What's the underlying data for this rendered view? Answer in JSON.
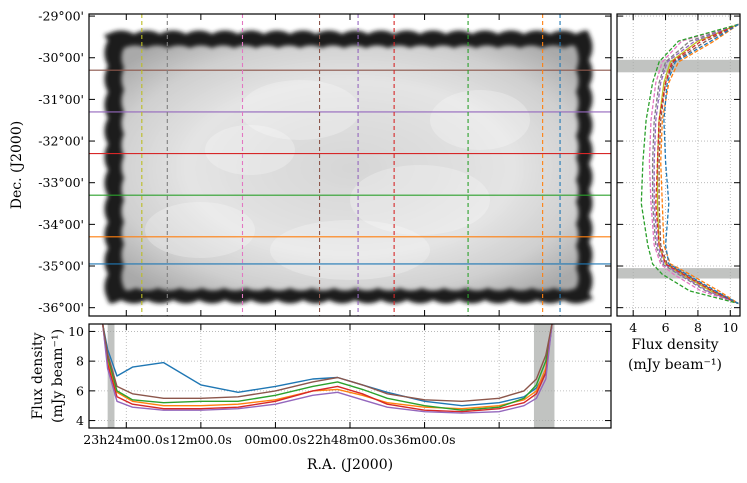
{
  "chart_data": [
    {
      "type": "heatmap",
      "xlabel": "",
      "ylabel": "Dec. (J2000)",
      "ytick_labels": [
        "-29°00'",
        "-30°00'",
        "-31°00'",
        "-32°00'",
        "-33°00'",
        "-34°00'",
        "-35°00'",
        "-36°00'"
      ],
      "ylim": [
        -36.2,
        -28.95
      ],
      "colormap": "grayscale",
      "horizontal_cuts": [
        {
          "dec": -30.3,
          "color": "#8c564b"
        },
        {
          "dec": -31.3,
          "color": "#9467bd"
        },
        {
          "dec": -32.3,
          "color": "#d62728"
        },
        {
          "dec": -33.3,
          "color": "#2ca02c"
        },
        {
          "dec": -34.3,
          "color": "#ff7f0e"
        },
        {
          "dec": -34.95,
          "color": "#1f77b4"
        }
      ],
      "vertical_cuts": [
        {
          "ra_min": -33.5,
          "color": "#bcbd22"
        },
        {
          "ra_min": -29.4,
          "color": "#7f7f7f"
        },
        {
          "ra_min": -17.3,
          "color": "#e377c2"
        },
        {
          "ra_min": -4.9,
          "color": "#8c564b"
        },
        {
          "ra_min": 1.3,
          "color": "#9467bd"
        },
        {
          "ra_min": 7.1,
          "color": "#d62728"
        },
        {
          "ra_min": 19.0,
          "color": "#2ca02c"
        },
        {
          "ra_min": 31.0,
          "color": "#ff7f0e"
        },
        {
          "ra_min": 33.8,
          "color": "#1f77b4"
        }
      ]
    },
    {
      "type": "line",
      "xlabel": "R.A. (J2000)",
      "ylabel": "Flux density\n(mJy beam⁻¹)",
      "xtick_labels": [
        "23h24m00.0s",
        "12m00.0s",
        "00m00.0s",
        "22h48m00.0s",
        "36m00.0s"
      ],
      "xtick_values_min": [
        -36,
        -24,
        -12,
        0,
        12,
        24
      ],
      "xlim_min": [
        -42,
        42
      ],
      "ylim": [
        3.5,
        10.5
      ],
      "ytick_labels": [
        "4",
        "6",
        "8",
        "10"
      ],
      "shaded_x_min": [
        [
          -39.0,
          -37.9
        ],
        [
          29.6,
          32.9
        ]
      ],
      "x": [
        -39.8,
        -39.0,
        -37.5,
        -35.0,
        -30.0,
        -24.0,
        -18.0,
        -12.0,
        -6.0,
        -2.0,
        2.0,
        6.0,
        12.0,
        18.0,
        24.0,
        28.0,
        30.0,
        31.5,
        32.5
      ],
      "series": [
        {
          "color": "#1f77b4",
          "values": [
            10.5,
            8.8,
            7.0,
            7.6,
            7.9,
            6.4,
            5.9,
            6.3,
            6.8,
            6.9,
            6.4,
            5.9,
            5.3,
            5.0,
            5.2,
            5.6,
            6.2,
            7.2,
            10.5
          ]
        },
        {
          "color": "#ff7f0e",
          "values": [
            10.5,
            8.0,
            5.9,
            5.3,
            5.0,
            5.0,
            5.1,
            5.4,
            6.0,
            6.1,
            5.7,
            5.2,
            4.9,
            4.8,
            5.0,
            5.4,
            6.0,
            7.5,
            10.5
          ]
        },
        {
          "color": "#2ca02c",
          "values": [
            10.5,
            8.3,
            6.0,
            5.4,
            5.2,
            5.3,
            5.3,
            5.7,
            6.3,
            6.6,
            6.1,
            5.5,
            5.0,
            4.7,
            4.9,
            5.5,
            6.4,
            8.0,
            10.5
          ]
        },
        {
          "color": "#d62728",
          "values": [
            10.5,
            7.8,
            5.6,
            5.1,
            4.8,
            4.8,
            4.9,
            5.3,
            6.0,
            6.3,
            5.8,
            5.1,
            4.7,
            4.6,
            4.8,
            5.2,
            5.8,
            7.2,
            10.5
          ]
        },
        {
          "color": "#9467bd",
          "values": [
            10.5,
            7.5,
            5.3,
            4.9,
            4.7,
            4.7,
            4.8,
            5.1,
            5.7,
            5.9,
            5.4,
            4.9,
            4.6,
            4.5,
            4.6,
            5.0,
            5.5,
            6.8,
            10.5
          ]
        },
        {
          "color": "#8c564b",
          "values": [
            10.5,
            8.5,
            6.3,
            5.8,
            5.5,
            5.5,
            5.6,
            6.0,
            6.6,
            6.9,
            6.4,
            5.8,
            5.4,
            5.3,
            5.5,
            6.0,
            6.8,
            8.4,
            10.5
          ]
        }
      ]
    },
    {
      "type": "line",
      "xlabel": "Flux density\n(mJy beam⁻¹)",
      "ylabel": "",
      "xtick_labels": [
        "4",
        "6",
        "8",
        "10"
      ],
      "xlim": [
        3.0,
        10.6
      ],
      "ylim": [
        -36.2,
        -28.95
      ],
      "shaded_dec": [
        [
          -30.35,
          -30.05
        ],
        [
          -35.3,
          -35.05
        ]
      ],
      "dec": [
        -29.2,
        -29.6,
        -30.1,
        -30.6,
        -31.5,
        -32.5,
        -33.5,
        -34.5,
        -34.95,
        -35.2,
        -35.6,
        -35.9
      ],
      "series": [
        {
          "color": "#bcbd22",
          "style": "solid",
          "values": [
            10.5,
            8.0,
            6.3,
            5.9,
            5.6,
            5.5,
            5.5,
            5.6,
            6.0,
            7.0,
            8.8,
            10.5
          ]
        },
        {
          "color": "#7f7f7f",
          "style": "dashed",
          "values": [
            10.5,
            7.5,
            6.0,
            5.6,
            5.3,
            5.2,
            5.2,
            5.4,
            5.8,
            6.8,
            8.5,
            10.5
          ]
        },
        {
          "color": "#e377c2",
          "style": "dashed",
          "values": [
            10.5,
            7.0,
            5.8,
            5.4,
            5.1,
            5.0,
            5.1,
            5.3,
            5.7,
            6.5,
            8.2,
            10.5
          ]
        },
        {
          "color": "#8c564b",
          "style": "dashed",
          "values": [
            10.5,
            8.5,
            6.5,
            6.0,
            5.7,
            5.6,
            5.6,
            5.7,
            6.1,
            7.2,
            9.0,
            10.5
          ]
        },
        {
          "color": "#9467bd",
          "style": "dashed",
          "values": [
            10.5,
            7.8,
            6.1,
            5.7,
            5.4,
            5.3,
            5.3,
            5.5,
            5.9,
            6.9,
            8.6,
            10.5
          ]
        },
        {
          "color": "#d62728",
          "style": "dashed",
          "values": [
            10.5,
            8.2,
            6.4,
            6.0,
            5.6,
            5.5,
            5.4,
            5.6,
            6.0,
            7.1,
            8.9,
            10.5
          ]
        },
        {
          "color": "#2ca02c",
          "style": "dashed",
          "values": [
            10.5,
            6.8,
            5.6,
            5.2,
            4.8,
            4.6,
            4.5,
            4.9,
            5.2,
            5.8,
            7.5,
            10.5
          ]
        },
        {
          "color": "#ff7f0e",
          "style": "dashed",
          "values": [
            10.5,
            9.0,
            6.8,
            6.2,
            5.8,
            5.7,
            5.8,
            5.9,
            6.3,
            7.5,
            9.3,
            10.5
          ]
        },
        {
          "color": "#1f77b4",
          "style": "dashed",
          "values": [
            10.5,
            8.8,
            6.6,
            6.1,
            5.9,
            6.0,
            6.2,
            6.0,
            6.2,
            7.3,
            9.1,
            10.5
          ]
        }
      ]
    }
  ]
}
